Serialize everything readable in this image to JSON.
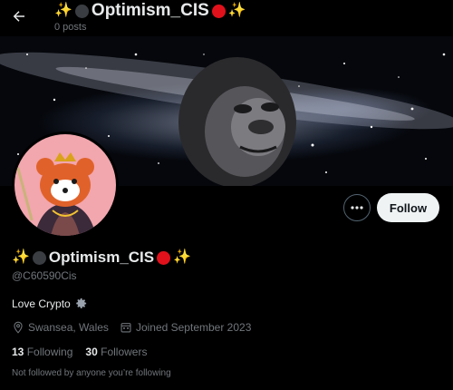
{
  "header": {
    "title_text": "Optimism_CIS",
    "posts_count": "0 posts"
  },
  "profile": {
    "display_name": "Optimism_CIS",
    "handle": "@C60590Cis",
    "bio": "Love Crypto",
    "location": "Swansea, Wales",
    "joined": "Joined September 2023",
    "following_count": "13",
    "following_label": "Following",
    "followers_count": "30",
    "followers_label": "Followers",
    "followed_by_note": "Not followed by anyone you’re following"
  },
  "actions": {
    "follow_label": "Follow"
  },
  "icons": {
    "back": "arrow-left-icon",
    "more": "more-dots-icon",
    "location": "location-pin-icon",
    "calendar": "calendar-icon",
    "gear": "gear-emoji-icon",
    "sparkle": "sparkles-emoji-icon",
    "grey_dot": "black-circle-emoji-icon",
    "red_dot": "red-circle-emoji-icon"
  },
  "colors": {
    "background": "#000000",
    "text_primary": "#e7e9ea",
    "text_secondary": "#71767b",
    "follow_button_bg": "#eff3f4",
    "avatar_bg": "#f2a6ae",
    "red_circle": "#e0111b",
    "sparkle": "#f5c518"
  }
}
